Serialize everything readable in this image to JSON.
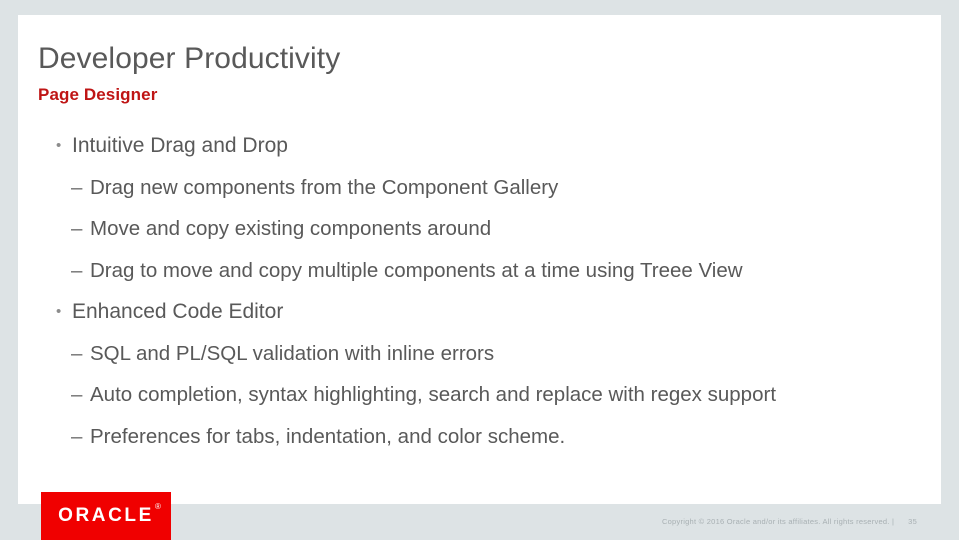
{
  "slide": {
    "title": "Developer Productivity",
    "subtitle": "Page Designer",
    "title_color": "#595959",
    "subtitle_color": "#bf1515",
    "background_color": "#dde3e5",
    "canvas_color": "#ffffff"
  },
  "bullets": [
    {
      "level": 1,
      "marker": "•",
      "text": "Intuitive Drag and Drop"
    },
    {
      "level": 2,
      "marker": "–",
      "text": "Drag new components from the Component Gallery"
    },
    {
      "level": 2,
      "marker": "–",
      "text": "Move and copy existing components around"
    },
    {
      "level": 2,
      "marker": "–",
      "text": "Drag to move and copy multiple components at a time using Treee View"
    },
    {
      "level": 1,
      "marker": "•",
      "text": "Enhanced Code Editor"
    },
    {
      "level": 2,
      "marker": "–",
      "text": "SQL and PL/SQL validation with inline errors"
    },
    {
      "level": 2,
      "marker": "–",
      "text": "Auto completion, syntax highlighting, search and replace with regex support"
    },
    {
      "level": 2,
      "marker": "–",
      "text": "Preferences for tabs, indentation, and color scheme."
    }
  ],
  "footer": {
    "logo_text": "ORACLE",
    "logo_trademark": "®",
    "logo_color": "#f00000",
    "copyright": "Copyright © 2016 Oracle and/or its affiliates. All rights reserved.  |",
    "page_number": "35"
  }
}
